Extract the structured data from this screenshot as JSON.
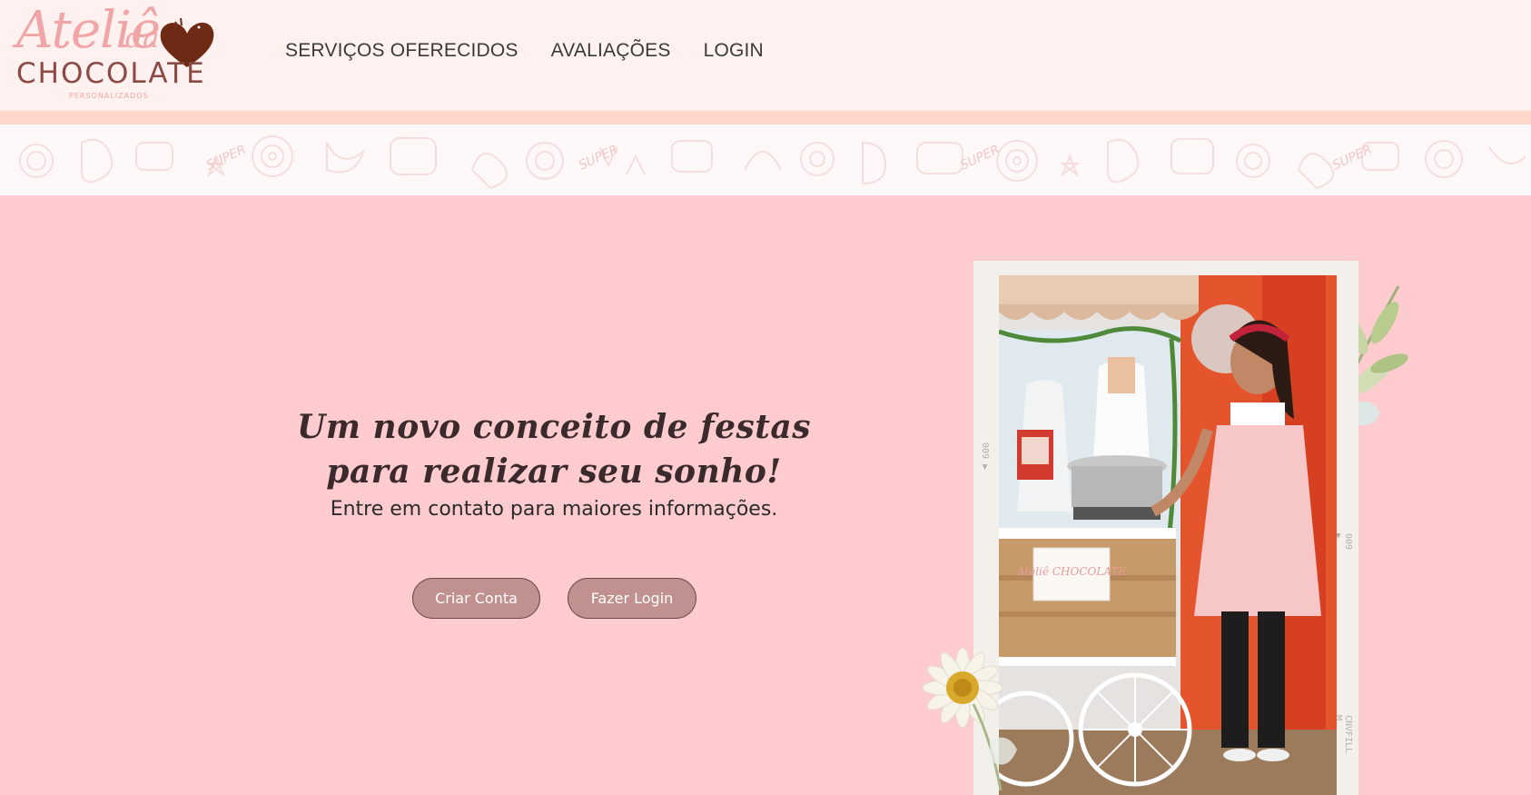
{
  "brand": {
    "script": "Ateliê",
    "script_small": "da",
    "word": "CHOCOLATE",
    "tagline": "PERSONALIZADOS"
  },
  "nav": {
    "items": [
      {
        "label": "SERVIÇOS OFERECIDOS"
      },
      {
        "label": "AVALIAÇÕES"
      },
      {
        "label": "LOGIN"
      }
    ]
  },
  "hero": {
    "headline": "Um novo conceito de festas para realizar seu sonho!",
    "subline": "Entre em contato para maiores informações.",
    "buttons": {
      "criar": "Criar Conta",
      "login": "Fazer Login"
    },
    "cart_logo": "Ateliê CHOCOLATE"
  },
  "colors": {
    "page_bg": "#fecbce",
    "header_bg": "#fff1ef",
    "button_bg": "#c19190",
    "brand_pink": "#f0a6a6",
    "brand_brown": "#8c4a44"
  }
}
